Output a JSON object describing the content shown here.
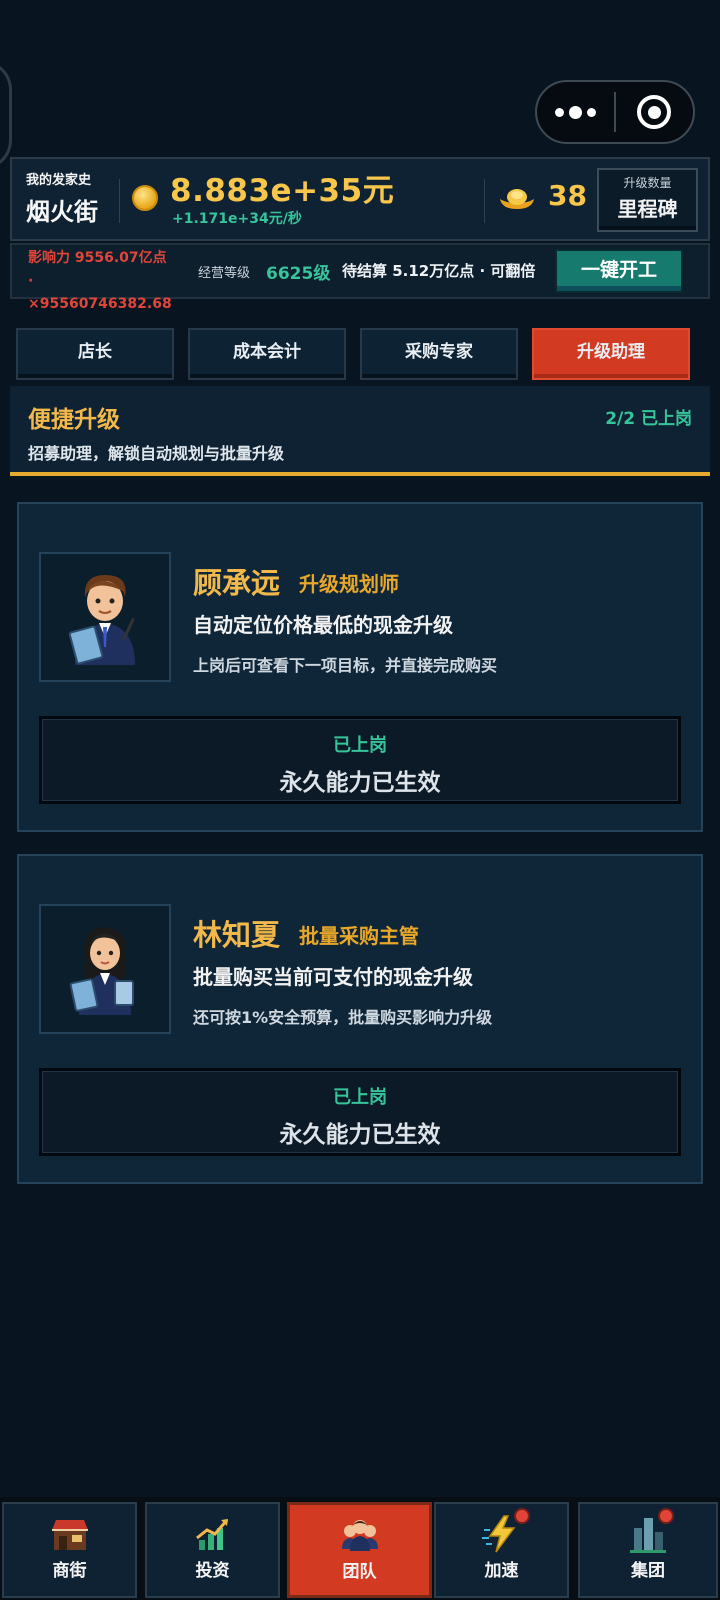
{
  "header": {
    "history_label": "我的发家史",
    "street_name": "烟火街",
    "money": "8.883e+35元",
    "rate": "+1.171e+34元/秒",
    "gold_count": "38",
    "milestone_small": "升级数量",
    "milestone_big": "里程碑"
  },
  "status_row": {
    "influence": "影响力 9556.07亿点\n·\n×95560746382.68",
    "level_label": "经营等级",
    "level_value": "6625级",
    "pending": "待结算 5.12万亿点 · 可翻倍",
    "one_click_label": "一键开工"
  },
  "tabs": [
    {
      "label": "店长",
      "active": false
    },
    {
      "label": "成本会计",
      "active": false
    },
    {
      "label": "采购专家",
      "active": false
    },
    {
      "label": "升级助理",
      "active": true
    }
  ],
  "section": {
    "title": "便捷升级",
    "status": "2/2 已上岗",
    "subtitle": "招募助理，解锁自动规划与批量升级"
  },
  "assistants": [
    {
      "name": "顾承远",
      "role": "升级规划师",
      "description": "自动定位价格最低的现金升级",
      "note": "上岗后可查看下一项目标，并直接完成购买",
      "status": "已上岗",
      "effect": "永久能力已生效"
    },
    {
      "name": "林知夏",
      "role": "批量采购主管",
      "description": "批量购买当前可支付的现金升级",
      "note": "还可按1%安全预算，批量购买影响力升级",
      "status": "已上岗",
      "effect": "永久能力已生效"
    }
  ],
  "bottom_nav": [
    {
      "label": "商街",
      "icon": "shop-street-icon",
      "active": false,
      "badge": false
    },
    {
      "label": "投资",
      "icon": "investment-chart-icon",
      "active": false,
      "badge": false
    },
    {
      "label": "团队",
      "icon": "team-icon",
      "active": true,
      "badge": false
    },
    {
      "label": "加速",
      "icon": "lightning-icon",
      "active": false,
      "badge": true
    },
    {
      "label": "集团",
      "icon": "group-buildings-icon",
      "active": false,
      "badge": true
    }
  ],
  "colors": {
    "accent_gold": "#f2b84a",
    "accent_green": "#37c49a",
    "accent_red": "#d23a22",
    "background": "#081520"
  }
}
